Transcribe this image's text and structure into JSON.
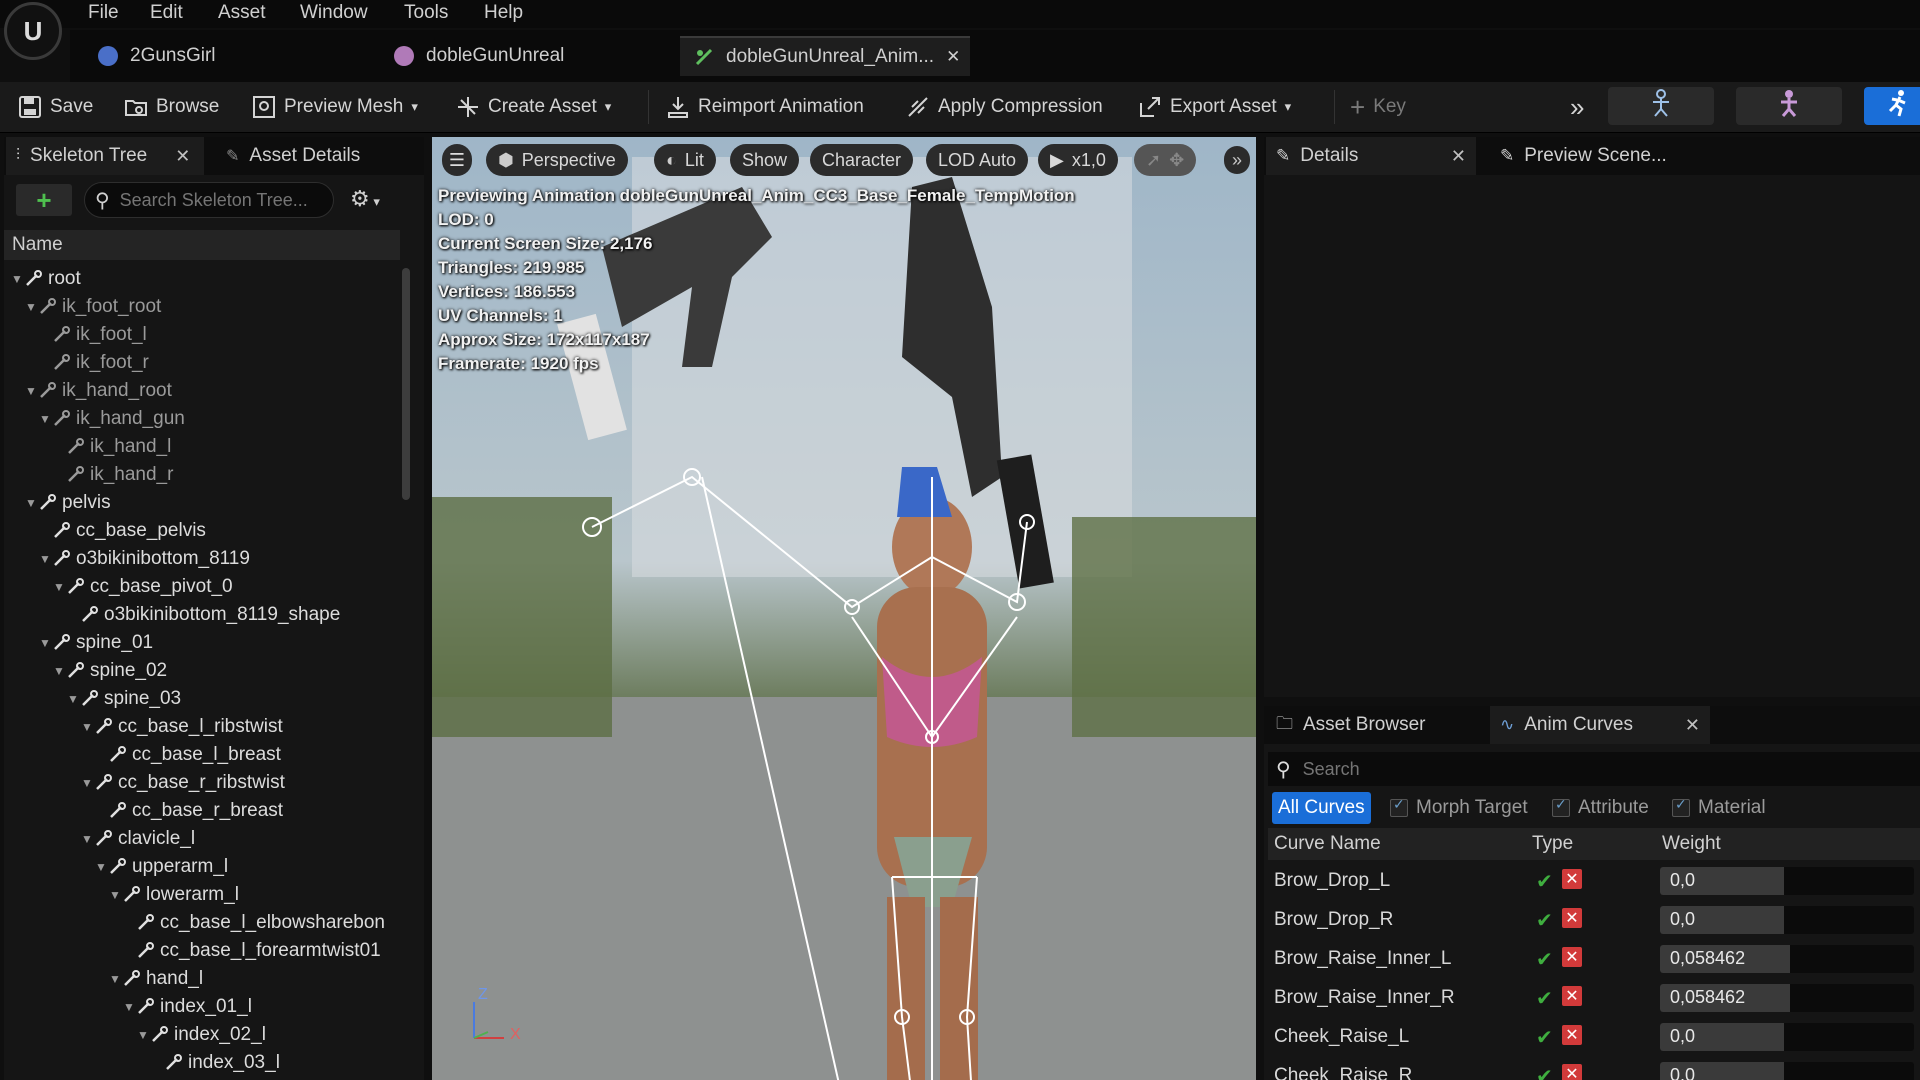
{
  "menu": {
    "items": [
      "File",
      "Edit",
      "Asset",
      "Window",
      "Tools",
      "Help"
    ]
  },
  "doc_tabs": [
    {
      "label": "2GunsGirl"
    },
    {
      "label": "dobleGunUnreal"
    },
    {
      "label": "dobleGunUnreal_Anim..."
    }
  ],
  "toolbar": {
    "save": "Save",
    "browse": "Browse",
    "preview_mesh": "Preview Mesh",
    "create_asset": "Create Asset",
    "reimport": "Reimport Animation",
    "apply_compression": "Apply Compression",
    "export_asset": "Export Asset",
    "key": "Key"
  },
  "left_tabs": {
    "skeleton_tree": "Skeleton Tree",
    "asset_details": "Asset Details"
  },
  "skeleton": {
    "search_placeholder": "Search Skeleton Tree...",
    "column": "Name",
    "bones": [
      "root",
      "ik_foot_root",
      "ik_foot_l",
      "ik_foot_r",
      "ik_hand_root",
      "ik_hand_gun",
      "ik_hand_l",
      "ik_hand_r",
      "pelvis",
      "cc_base_pelvis",
      "o3bikinibottom_8119",
      "cc_base_pivot_0",
      "o3bikinibottom_8119_shape",
      "spine_01",
      "spine_02",
      "spine_03",
      "cc_base_l_ribstwist",
      "cc_base_l_breast",
      "cc_base_r_ribstwist",
      "cc_base_r_breast",
      "clavicle_l",
      "upperarm_l",
      "lowerarm_l",
      "cc_base_l_elbowsharebon",
      "cc_base_l_forearmtwist01",
      "hand_l",
      "index_01_l",
      "index_02_l",
      "index_03_l"
    ]
  },
  "viewport": {
    "perspective": "Perspective",
    "lit": "Lit",
    "show": "Show",
    "character": "Character",
    "lod": "LOD Auto",
    "speed": "x1,0",
    "stats": [
      "Previewing Animation dobleGunUnreal_Anim_CC3_Base_Female_TempMotion",
      "LOD: 0",
      "Current Screen Size: 2,176",
      "Triangles: 219.985",
      "Vertices: 186.553",
      "UV Channels: 1",
      "Approx Size: 172x117x187",
      "Framerate: 1920 fps"
    ],
    "axis_z": "Z",
    "axis_x": "X"
  },
  "right_tabs": {
    "details": "Details",
    "preview_scene": "Preview Scene..."
  },
  "bottom_tabs": {
    "asset_browser": "Asset Browser",
    "anim_curves": "Anim Curves"
  },
  "anim_curves": {
    "search_placeholder": "Search",
    "filters": {
      "all": "All Curves",
      "morph": "Morph Target",
      "attribute": "Attribute",
      "material": "Material"
    },
    "columns": {
      "name": "Curve Name",
      "type": "Type",
      "weight": "Weight"
    },
    "rows": [
      {
        "name": "Brow_Drop_L",
        "weight": "0,0",
        "fill": 0.0
      },
      {
        "name": "Brow_Drop_R",
        "weight": "0,0",
        "fill": 0.0
      },
      {
        "name": "Brow_Raise_Inner_L",
        "weight": "0,058462",
        "fill": 0.058
      },
      {
        "name": "Brow_Raise_Inner_R",
        "weight": "0,058462",
        "fill": 0.058
      },
      {
        "name": "Cheek_Raise_L",
        "weight": "0,0",
        "fill": 0.0
      },
      {
        "name": "Cheek_Raise_R",
        "weight": "0,0",
        "fill": 0.0
      }
    ]
  },
  "colors": {
    "accent": "#1a6ed8",
    "panel": "#151515",
    "check_green": "#3fae3f",
    "check_red": "#d23a3a"
  }
}
